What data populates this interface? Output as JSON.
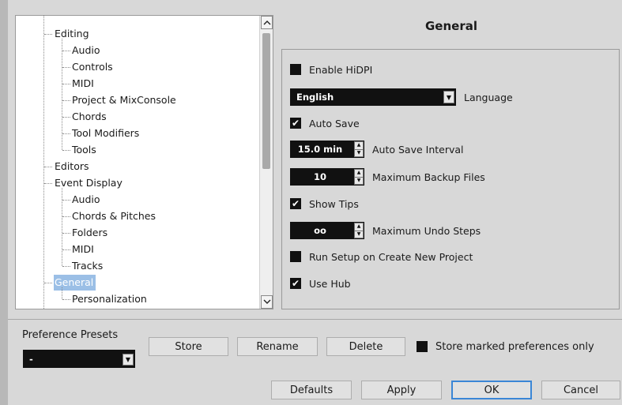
{
  "tree": {
    "items": [
      {
        "label": "Editing",
        "level": 1
      },
      {
        "label": "Audio",
        "level": 2
      },
      {
        "label": "Controls",
        "level": 2
      },
      {
        "label": "MIDI",
        "level": 2
      },
      {
        "label": "Project & MixConsole",
        "level": 2
      },
      {
        "label": "Chords",
        "level": 2
      },
      {
        "label": "Tool Modifiers",
        "level": 2
      },
      {
        "label": "Tools",
        "level": 2
      },
      {
        "label": "Editors",
        "level": 1
      },
      {
        "label": "Event Display",
        "level": 1
      },
      {
        "label": "Audio",
        "level": 2
      },
      {
        "label": "Chords & Pitches",
        "level": 2
      },
      {
        "label": "Folders",
        "level": 2
      },
      {
        "label": "MIDI",
        "level": 2
      },
      {
        "label": "Tracks",
        "level": 2
      },
      {
        "label": "General",
        "level": 1,
        "selected": true
      },
      {
        "label": "Personalization",
        "level": 2
      }
    ],
    "scroll_up_icon": "chevron-up-icon",
    "scroll_down_icon": "chevron-down-icon"
  },
  "general": {
    "title": "General",
    "enable_hidpi": {
      "label": "Enable HiDPI",
      "checked": false
    },
    "language": {
      "value": "English",
      "label": "Language"
    },
    "auto_save": {
      "label": "Auto Save",
      "checked": true
    },
    "auto_save_interval": {
      "value": "15.0 min",
      "label": "Auto Save Interval"
    },
    "max_backup_files": {
      "value": "10",
      "label": "Maximum Backup Files"
    },
    "show_tips": {
      "label": "Show Tips",
      "checked": true
    },
    "max_undo_steps": {
      "value": "oo",
      "label": "Maximum Undo Steps"
    },
    "run_setup": {
      "label": "Run Setup on Create New Project",
      "checked": false
    },
    "use_hub": {
      "label": "Use Hub",
      "checked": true
    }
  },
  "presets": {
    "label": "Preference Presets",
    "selected": "-",
    "store_label": "Store",
    "rename_label": "Rename",
    "delete_label": "Delete",
    "store_marked": {
      "label": "Store marked preferences only",
      "checked": false
    }
  },
  "footer": {
    "defaults_label": "Defaults",
    "apply_label": "Apply",
    "ok_label": "OK",
    "cancel_label": "Cancel"
  },
  "colors": {
    "selection": "#9bbfe6",
    "default_button_border": "#3a86d6",
    "control_bg": "#111111"
  },
  "check_glyph": "✔"
}
